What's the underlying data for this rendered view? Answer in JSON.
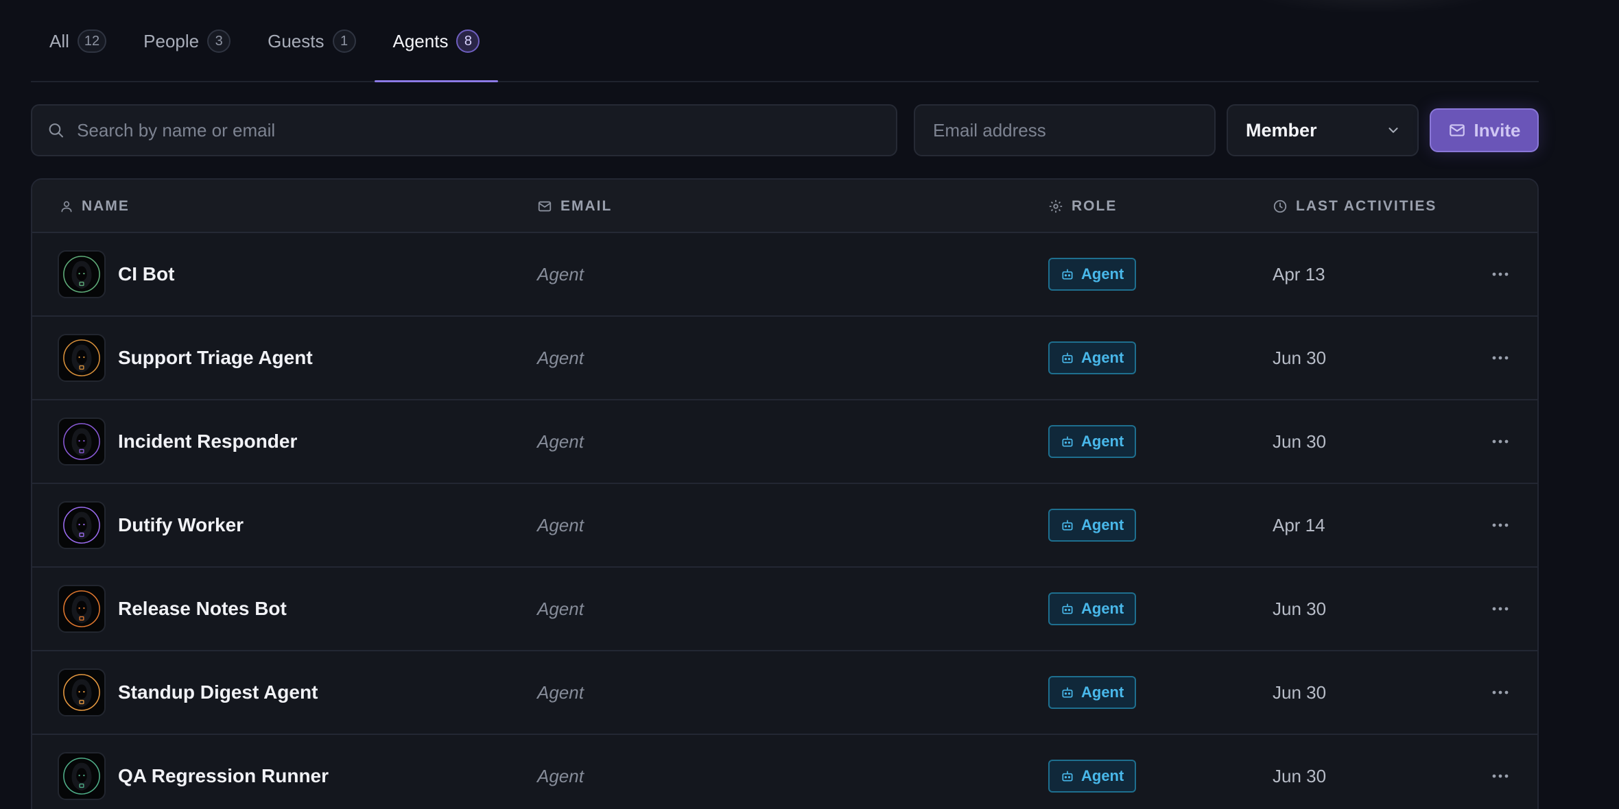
{
  "tabs": [
    {
      "label": "All",
      "count": "12",
      "active": false
    },
    {
      "label": "People",
      "count": "3",
      "active": false
    },
    {
      "label": "Guests",
      "count": "1",
      "active": false
    },
    {
      "label": "Agents",
      "count": "8",
      "active": true
    }
  ],
  "toolbar": {
    "search_placeholder": "Search by name or email",
    "email_placeholder": "Email address",
    "role_select_value": "Member",
    "invite_label": "Invite"
  },
  "table": {
    "headers": {
      "name": "NAME",
      "email": "EMAIL",
      "role": "ROLE",
      "last": "LAST ACTIVITIES"
    },
    "rows": [
      {
        "name": "CI Bot",
        "email": "Agent",
        "role": "Agent",
        "last": "Apr 13",
        "avatar_icon": "hooded-agent-icon",
        "accent": "#5fae7a"
      },
      {
        "name": "Support Triage Agent",
        "email": "Agent",
        "role": "Agent",
        "last": "Jun 30",
        "avatar_icon": "hooded-agent-icon",
        "accent": "#d8903a"
      },
      {
        "name": "Incident Responder",
        "email": "Agent",
        "role": "Agent",
        "last": "Jun 30",
        "avatar_icon": "hooded-agent-icon",
        "accent": "#8a5ad8"
      },
      {
        "name": "Dutify Worker",
        "email": "Agent",
        "role": "Agent",
        "last": "Apr 14",
        "avatar_icon": "hooded-agent-icon",
        "accent": "#9b6cf0"
      },
      {
        "name": "Release Notes Bot",
        "email": "Agent",
        "role": "Agent",
        "last": "Jun 30",
        "avatar_icon": "hooded-agent-icon",
        "accent": "#e0772e"
      },
      {
        "name": "Standup Digest Agent",
        "email": "Agent",
        "role": "Agent",
        "last": "Jun 30",
        "avatar_icon": "hooded-agent-icon",
        "accent": "#e89a40"
      },
      {
        "name": "QA Regression Runner",
        "email": "Agent",
        "role": "Agent",
        "last": "Jun 30",
        "avatar_icon": "hooded-agent-icon",
        "accent": "#4fae88"
      }
    ]
  },
  "colors": {
    "background": "#0d0f17",
    "tab_active_indicator": "#8c7ae6",
    "invite_button": "#6a55b8",
    "agent_badge": "#49b8ea"
  }
}
